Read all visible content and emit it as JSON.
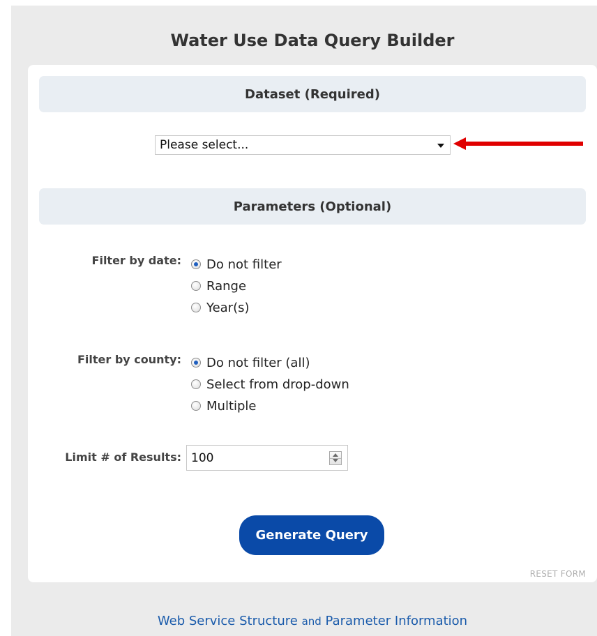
{
  "title": "Water Use Data Query Builder",
  "dataset_section": {
    "header": "Dataset (Required)",
    "select_value": "Please select..."
  },
  "parameters_section": {
    "header": "Parameters (Optional)",
    "date_filter": {
      "label": "Filter by date:",
      "options": [
        "Do not filter",
        "Range",
        "Year(s)"
      ],
      "selected": "Do not filter"
    },
    "county_filter": {
      "label": "Filter by county:",
      "options": [
        "Do not filter (all)",
        "Select from drop-down",
        "Multiple"
      ],
      "selected": "Do not filter (all)"
    },
    "limit": {
      "label": "Limit # of Results:",
      "value": "100"
    }
  },
  "buttons": {
    "generate": "Generate Query",
    "reset": "RESET FORM"
  },
  "footer": {
    "link_part1": "Web Service Structure",
    "link_and": "and",
    "link_part2": "Parameter Information"
  },
  "colors": {
    "primary_button": "#0a4aa8",
    "link": "#1a5bab",
    "arrow": "#e00000",
    "section_header_bg": "#e9eef3",
    "page_bg": "#ebebeb"
  },
  "icons": {
    "dropdown": "chevron-down-icon",
    "annotation": "red-arrow-icon",
    "stepper": "spinner-icon"
  }
}
